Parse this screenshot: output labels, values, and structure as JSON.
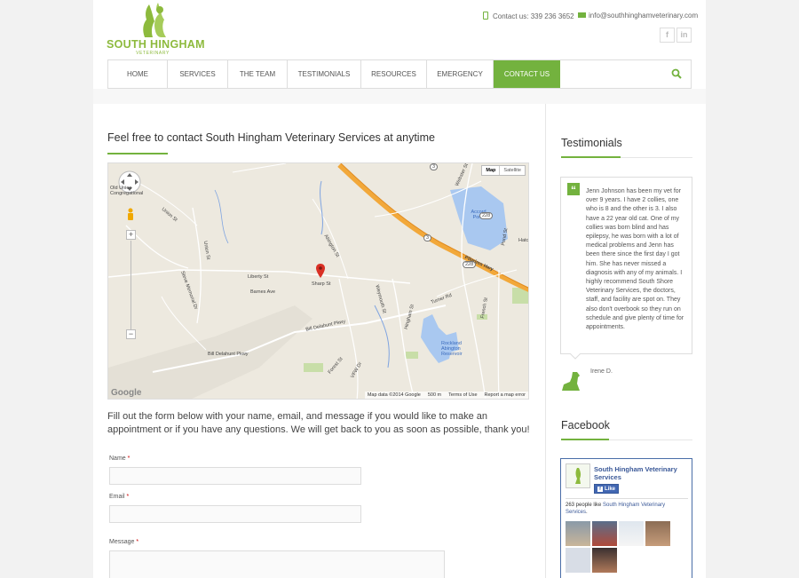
{
  "header": {
    "logo": {
      "name": "SOUTH HINGHAM",
      "sub": "VETERINARY"
    },
    "contact_phone": "Contact us: 339 236 3652",
    "contact_email": "info@southhinghamveterinary.com",
    "social": [
      "f",
      "in"
    ]
  },
  "nav": {
    "items": [
      {
        "label": "HOME"
      },
      {
        "label": "SERVICES"
      },
      {
        "label": "THE TEAM"
      },
      {
        "label": "TESTIMONIALS"
      },
      {
        "label": "RESOURCES"
      },
      {
        "label": "EMERGENCY"
      },
      {
        "label": "CONTACT US",
        "active": true
      }
    ],
    "search_icon": "search-icon"
  },
  "main": {
    "heading": "Feel free to contact South Hingham Veterinary Services at anytime",
    "map": {
      "tab_map": "Map",
      "tab_satellite": "Satellite",
      "zoom_in": "+",
      "zoom_out": "−",
      "footer": [
        "Map data ©2014 Google",
        "500 m",
        "Terms of Use",
        "Report a map error"
      ],
      "labels": {
        "sharp_st": "Sharp St",
        "liberty_st": "Liberty St",
        "pilgrims_hwy": "Pilgrims Hwy",
        "accord_pond": "Accord Pond",
        "bill_delahunt": "Bill Delahunt Pkwy",
        "bill_delahunt2": "Bill Delahunt Pkwy",
        "rockland": "Rockland Abington Reservoir",
        "hingham_st": "Hingham St",
        "union_st": "Union St",
        "webster_st": "Webster St",
        "pond_st": "Pond St",
        "french_st": "French St",
        "turner_rd": "Turner Rd",
        "abington_st": "Abington St",
        "forest_st": "Forest St",
        "old_union": "Old Union Congregational",
        "barnes_ave": "Barnes Ave",
        "steve_memorial": "Steve Memorial Dr",
        "union_st_2": "Union St",
        "weymouth_st": "Weymouth St",
        "hatch": "Hatc",
        "vfw": "VFW Dr",
        "route_3": "3",
        "route_3b": "3",
        "route_228": "228",
        "route_228b": "228",
        "google": "Google"
      }
    },
    "intro": "Fill out the form below with your name, email, and message if you would like to make an appointment or if you have any questions. We will get back to you as soon as possible, thank you!",
    "form": {
      "name_label": "Name",
      "email_label": "Email",
      "message_label": "Message",
      "required_mark": "*"
    }
  },
  "sidebar": {
    "testimonials_title": "Testimonials",
    "testimonial_text": "Jenn Johnson has been my vet for over 9 years. I have 2 collies, one who is 8 and the other is 3. I also have a 22 year old cat. One of my collies was born blind and has epilepsy, he was born with a lot of medical problems and Jenn has been there since the first day I got him. She has never missed a diagnosis with any of my animals. I highly recommend South Shore Veterinary Services, the doctors, staff, and facility are spot on. They also don't overbook so they run on schedule and give plenty of time for appointments.",
    "testimonial_author": "Irene D.",
    "facebook_title": "Facebook",
    "fb": {
      "page_name": "South Hingham Veterinary Services",
      "like_button": "Like",
      "likes_text_prefix": "263 people like ",
      "likes_link": "South Hingham Veterinary Services",
      "likes_suffix": "."
    }
  },
  "colors": {
    "accent": "#73b23e",
    "logo": "#8dba3d",
    "fb_blue": "#3b5998"
  }
}
